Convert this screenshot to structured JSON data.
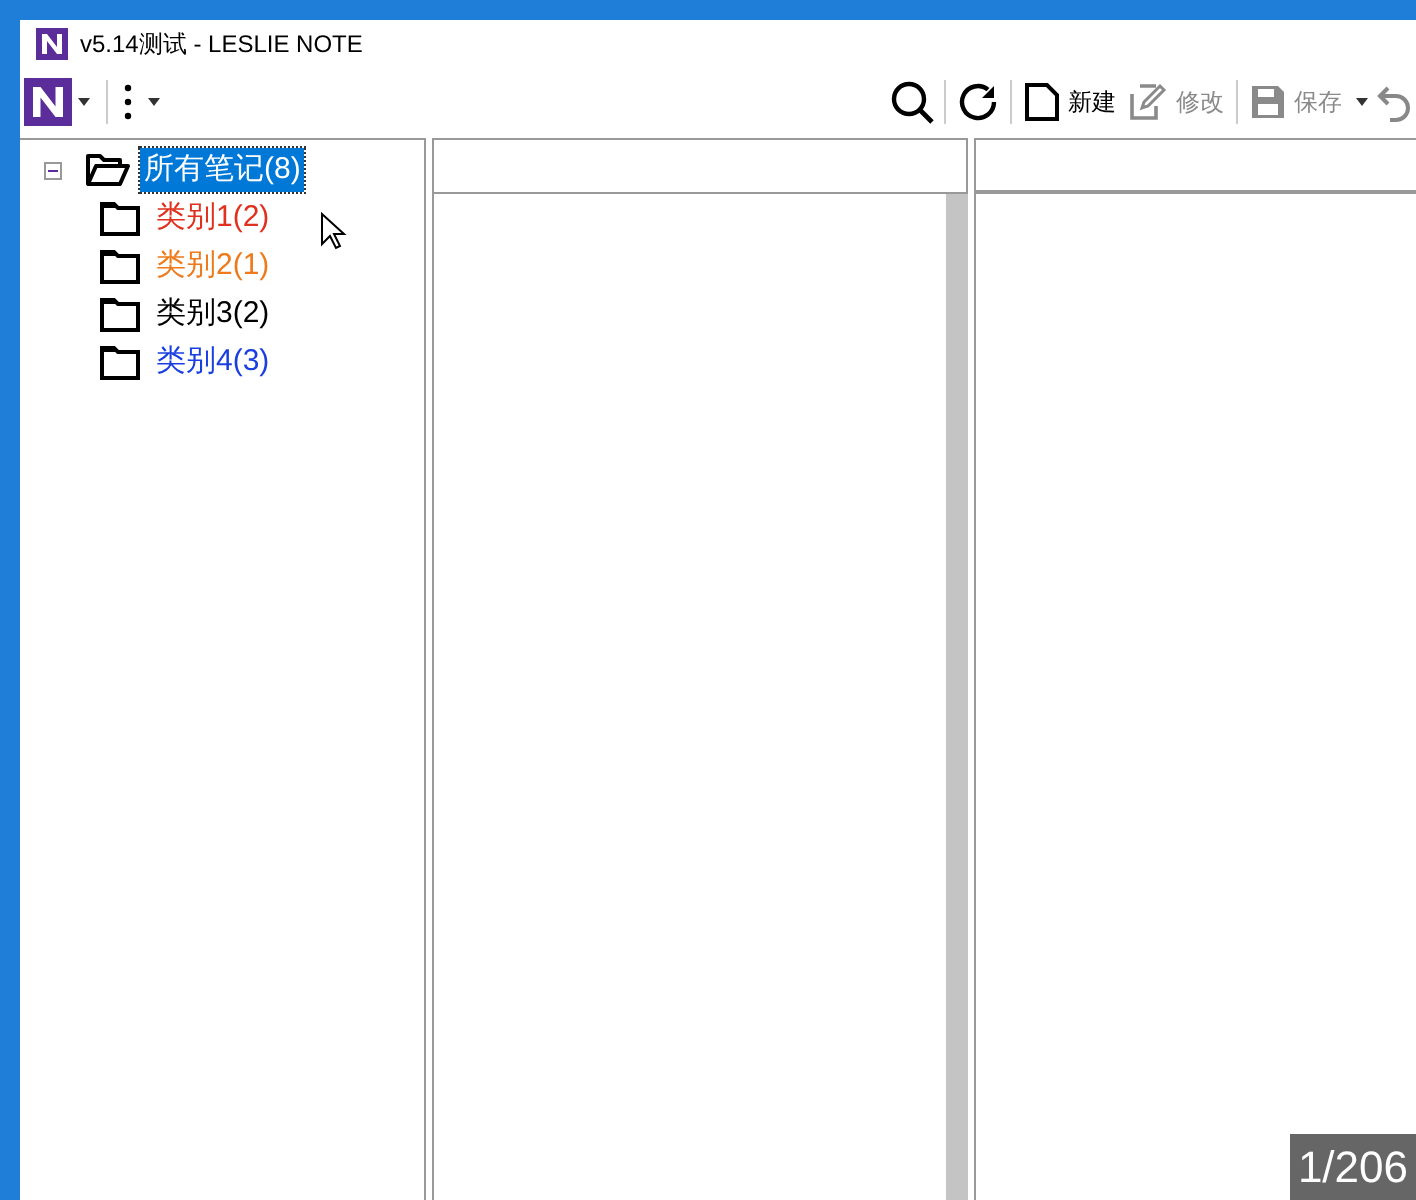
{
  "window": {
    "title": "v5.14测试 - LESLIE NOTE"
  },
  "toolbar": {
    "actions": [
      {
        "kind": "new",
        "label": "新建",
        "disabled": false
      },
      {
        "kind": "edit",
        "label": "修改",
        "disabled": true
      },
      {
        "kind": "save",
        "label": "保存",
        "disabled": true
      }
    ]
  },
  "tree": {
    "label": "所有笔记(8)",
    "expanded": true,
    "selected": true,
    "children": [
      {
        "label": "类别1(2)",
        "color": "#e0301e",
        "selected": false
      },
      {
        "label": "类别2(1)",
        "color": "#ee7a1c",
        "selected": false
      },
      {
        "label": "类别3(2)",
        "color": "#000000",
        "selected": false
      },
      {
        "label": "类别4(3)",
        "color": "#1a3fe0",
        "selected": false
      }
    ]
  },
  "page_counter": "1/206"
}
